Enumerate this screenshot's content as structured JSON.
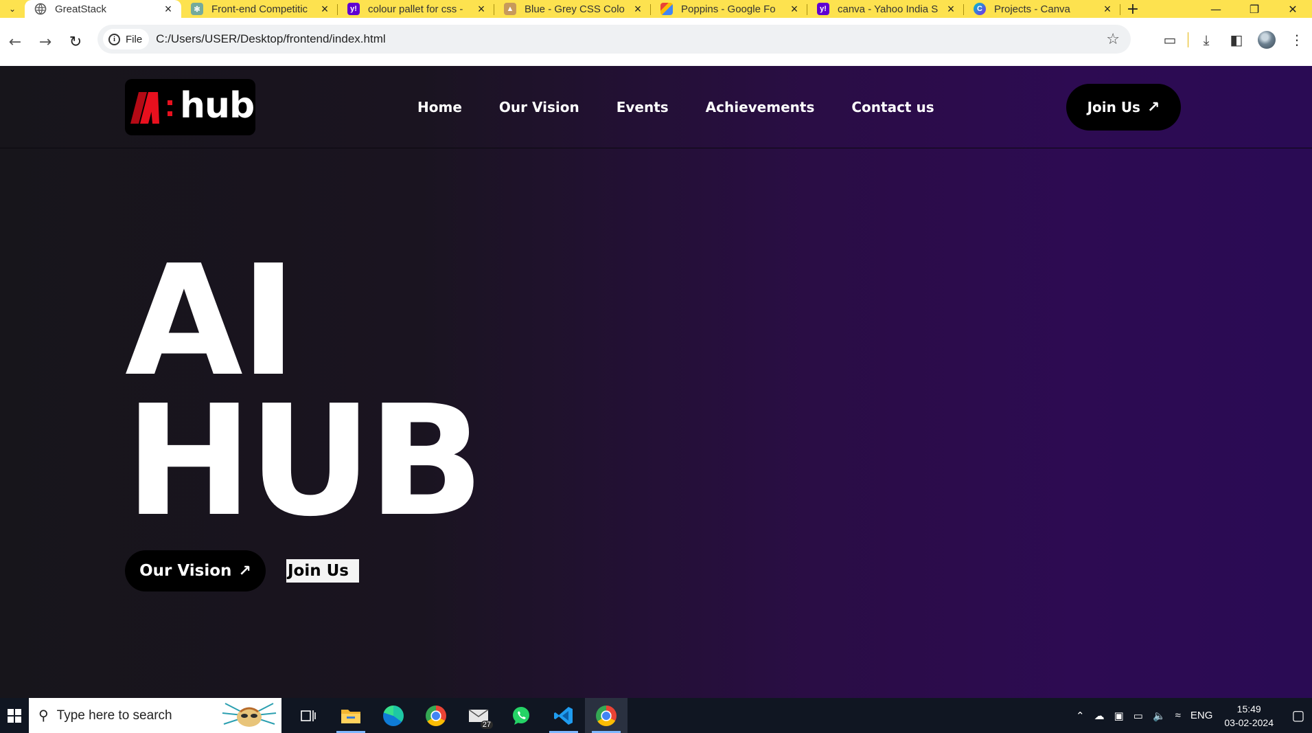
{
  "browser": {
    "tabs": [
      {
        "title": "GreatStack",
        "active": true,
        "favicon": "globe-icon"
      },
      {
        "title": "Front-end Competitic",
        "active": false,
        "favicon": "chatgpt-icon"
      },
      {
        "title": "colour pallet for css -",
        "active": false,
        "favicon": "yahoo-icon"
      },
      {
        "title": "Blue - Grey CSS Colo",
        "active": false,
        "favicon": "palette-icon"
      },
      {
        "title": "Poppins - Google Fo",
        "active": false,
        "favicon": "google-fonts-icon"
      },
      {
        "title": "canva - Yahoo India S",
        "active": false,
        "favicon": "yahoo-icon"
      },
      {
        "title": "Projects - Canva",
        "active": false,
        "favicon": "canva-icon"
      }
    ],
    "address": {
      "chip_label": "File",
      "url": "C:/Users/USER/Desktop/frontend/index.html"
    },
    "tab_bar_color": "#fde24f"
  },
  "site": {
    "logo_text": "hub",
    "nav": [
      "Home",
      "Our Vision",
      "Events",
      "Achievements",
      "Contact us"
    ],
    "join_button": "Join Us",
    "hero": {
      "line1": "AI",
      "line2": "HUB"
    },
    "cta_primary": "Our Vision",
    "cta_secondary": "Join Us",
    "colors": {
      "bg_left": "#17151b",
      "bg_right": "#2d0b52",
      "logo_accent": "#e8101e"
    }
  },
  "taskbar": {
    "search_placeholder": "Type here to search",
    "mail_badge": "27",
    "language": "ENG",
    "time": "15:49",
    "date": "03-02-2024"
  }
}
